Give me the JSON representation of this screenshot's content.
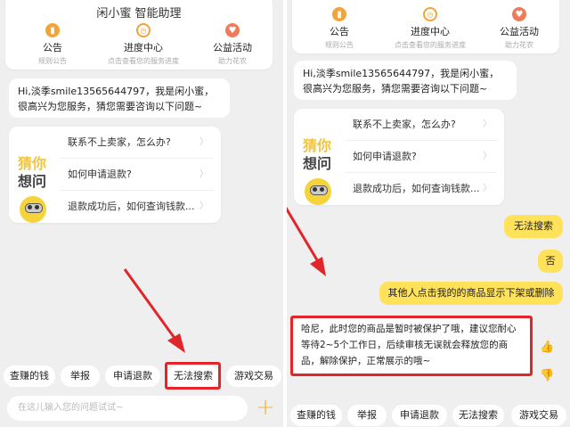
{
  "left": {
    "header_title": "闲小蜜 智能助理",
    "quick_links": [
      {
        "label": "公告",
        "sub": "规则公告",
        "icon": "notice-icon"
      },
      {
        "label": "进度中心",
        "sub": "点击查看您的服务进度",
        "icon": "progress-clock-icon"
      },
      {
        "label": "公益活动",
        "sub": "助力花农",
        "icon": "heart-icon"
      }
    ],
    "greeting": "Hi,淡季smile13565644797，我是闲小蜜，很高兴为您服务，猜您需要咨询以下问题~",
    "guess_slogan": {
      "line1": "猜你",
      "line2": "想问"
    },
    "questions": [
      "联系不上卖家，怎么办?",
      "如何申请退款?",
      "退款成功后，如何查询钱款..."
    ],
    "chips": [
      "查赚的钱",
      "举报",
      "申请退款",
      "无法搜索",
      "游戏交易"
    ],
    "input_placeholder": "在这儿输入您的问题试试~"
  },
  "right": {
    "quick_links": [
      {
        "label": "公告",
        "sub": "规则公告",
        "icon": "notice-icon"
      },
      {
        "label": "进度中心",
        "sub": "点击查看您的服务进度",
        "icon": "progress-clock-icon"
      },
      {
        "label": "公益活动",
        "sub": "助力花农",
        "icon": "heart-icon"
      }
    ],
    "greeting": "Hi,淡季smile13565644797，我是闲小蜜，很高兴为您服务，猜您需要咨询以下问题~",
    "guess_slogan": {
      "line1": "猜你",
      "line2": "想问"
    },
    "questions": [
      "联系不上卖家，怎么办?",
      "如何申请退款?",
      "退款成功后，如何查询钱款..."
    ],
    "user_messages": [
      "无法搜索",
      "否",
      "其他人点击我的的商品显示下架或删除"
    ],
    "bot_reply": "哈尼，此时您的商品是暂时被保护了哦，建议您耐心等待2~5个工作日，后续审核无误就会释放您的商品，解除保护，正常展示的哦~",
    "chips": [
      "查赚的钱",
      "举报",
      "申请退款",
      "无法搜索",
      "游戏交易"
    ]
  },
  "colors": {
    "accent": "#ffe15a",
    "highlight": "#e0262b",
    "plus": "#f2b53a"
  }
}
